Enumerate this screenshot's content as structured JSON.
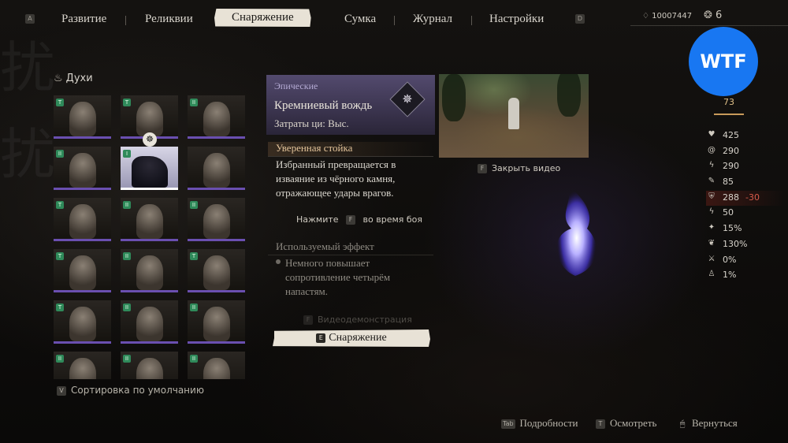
{
  "nav": {
    "left_key": "A",
    "right_key": "D",
    "tabs": [
      "Развитие",
      "Реликвии",
      "Снаряжение",
      "Сумка",
      "Журнал",
      "Настройки"
    ],
    "active_tab": "Снаряжение"
  },
  "currency": {
    "will": "10007447",
    "sparks": "6"
  },
  "category": {
    "label": "Духи"
  },
  "grid": {
    "tiles": [
      {
        "badge": "T"
      },
      {
        "badge": "T"
      },
      {
        "badge": "II"
      },
      {
        "badge": "II"
      },
      {
        "badge": "I",
        "selected": true
      },
      {
        "badge": ""
      },
      {
        "badge": "T"
      },
      {
        "badge": "II"
      },
      {
        "badge": "II"
      },
      {
        "badge": "T"
      },
      {
        "badge": "II"
      },
      {
        "badge": "T"
      },
      {
        "badge": "T"
      },
      {
        "badge": "II"
      },
      {
        "badge": "II"
      },
      {
        "badge": "II"
      },
      {
        "badge": "II"
      },
      {
        "badge": "II"
      }
    ],
    "equipped_marker": "☸"
  },
  "sort": {
    "key": "V",
    "label": "Сортировка по умолчанию"
  },
  "detail": {
    "rarity": "Эпические",
    "name": "Кремниевый вождь",
    "cost": "Затраты ци: Выс.",
    "section_active": "Уверенная стойка",
    "active_desc": "Избранный превращается в изваяние из чёрного камня, отражающее удары врагов.",
    "press_prefix": "Нажмите",
    "press_key": "F",
    "press_suffix": "во время боя",
    "section_passive": "Используемый эффект",
    "passive_desc": "Немного повышает сопротивление четырём напастям.",
    "video_key": "F",
    "video_demo": "Видеодемонстрация",
    "equip_key": "E",
    "equip_label": "Снаряжение"
  },
  "video": {
    "close_key": "F",
    "close_label": "Закрыть видео"
  },
  "badge": {
    "text": "WTF",
    "color": "#1877f2"
  },
  "stamina": "73",
  "stats": [
    {
      "icon": "heart-icon",
      "glyph": "♥",
      "value": "425",
      "delta": ""
    },
    {
      "icon": "swirl-icon",
      "glyph": "@",
      "value": "290",
      "delta": ""
    },
    {
      "icon": "bolt-icon",
      "glyph": "ϟ",
      "value": "290",
      "delta": ""
    },
    {
      "icon": "staff-icon",
      "glyph": "✎",
      "value": "85",
      "delta": ""
    },
    {
      "icon": "shield-icon",
      "glyph": "⛨",
      "value": "288",
      "delta": "-30"
    },
    {
      "icon": "strike-icon",
      "glyph": "ϟ",
      "value": "50",
      "delta": ""
    },
    {
      "icon": "claw-icon",
      "glyph": "✦",
      "value": "15%",
      "delta": ""
    },
    {
      "icon": "wing-icon",
      "glyph": "❦",
      "value": "130%",
      "delta": ""
    },
    {
      "icon": "cross-icon",
      "glyph": "⚔",
      "value": "0%",
      "delta": ""
    },
    {
      "icon": "gourd-icon",
      "glyph": "♙",
      "value": "1%",
      "delta": ""
    }
  ],
  "hints": [
    {
      "key": "Tab",
      "label": "Подробности"
    },
    {
      "key": "T",
      "label": "Осмотреть"
    },
    {
      "key": "🖱",
      "label": "Вернуться"
    }
  ],
  "colors": {
    "rarity_purple": "#6a4fb0",
    "accent_gold": "#e2c39a",
    "debuff_red": "#d85a4a"
  }
}
